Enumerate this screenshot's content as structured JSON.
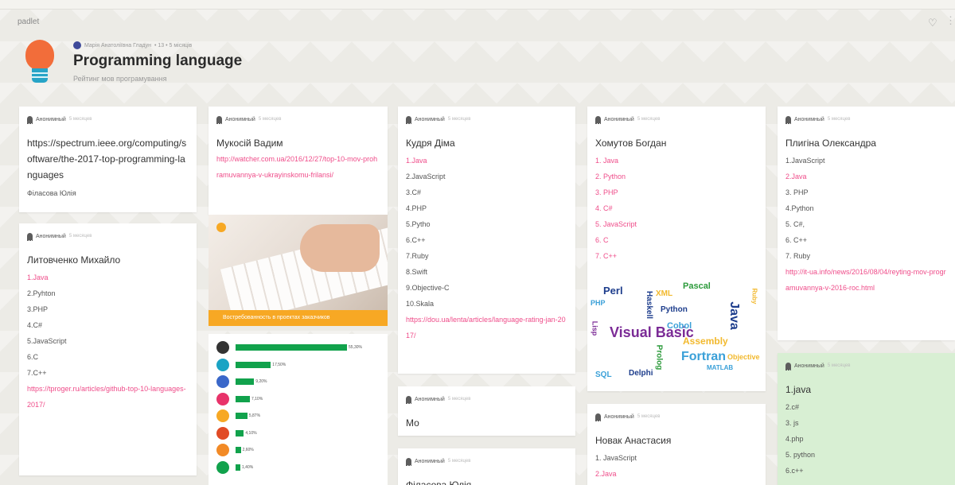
{
  "app": {
    "brand": "padlet",
    "heart_icon": "heart-icon"
  },
  "header": {
    "author": "Марія Анатоліївна Гладун",
    "meta": "• 13 • 5 місяців",
    "title": "Programming language",
    "subtitle": "Рейтинг мов програмування"
  },
  "posts": {
    "c1": {
      "author": "Анонимный",
      "time": "5 месяцев",
      "title": "https://spectrum.ieee.org/computing/software/the-2017-top-programming-languages",
      "body": "Філасова Юлія"
    },
    "c2": {
      "author": "Анонимный",
      "time": "5 месяцев",
      "title": "Литовченко Михайло",
      "items": [
        "1.Java",
        "2.Pyhton",
        "3.PHP",
        "4.C#",
        "5.JavaScript",
        "6.C",
        "7.C++"
      ],
      "link": "https://tproger.ru/articles/github-top-10-languages-2017/"
    },
    "c3": {
      "author": "Анонимный",
      "time": "5 месяцев",
      "title": "Мукосій Вадим",
      "link": "http://watcher.com.ua/2016/12/27/top-10-mov-prohramuvannya-v-ukrayinskomu-frilansi/",
      "image_banner": "Востребованность в проектах заказчиков",
      "bars": [
        {
          "value": 55.3,
          "label": "55,30%",
          "color": "#333333"
        },
        {
          "value": 17.5,
          "label": "17,50%",
          "color": "#1aa3c4"
        },
        {
          "value": 9.2,
          "label": "9,20%",
          "color": "#3a67c9"
        },
        {
          "value": 7.1,
          "label": "7,10%",
          "color": "#e8336a"
        },
        {
          "value": 5.87,
          "label": "5,87%",
          "color": "#f7a824"
        },
        {
          "value": 4.1,
          "label": "4,10%",
          "color": "#e14b25"
        },
        {
          "value": 2.6,
          "label": "2,60%",
          "color": "#f28a26"
        },
        {
          "value": 1.4,
          "label": "1,40%",
          "color": "#11a24c"
        }
      ]
    },
    "c4": {
      "author": "Анонимный",
      "time": "5 месяцев",
      "title": "Кудря Діма",
      "items": [
        "1.Java",
        "2.JavaScript",
        "3.C#",
        "4.PHP",
        "5.Pytho",
        "6.C++",
        "7.Ruby",
        "8.Swift",
        "9.Objective-C",
        "10.Skala"
      ],
      "link": "https://dou.ua/lenta/articles/language-rating-jan-2017/"
    },
    "c5": {
      "author": "Анонимный",
      "time": "5 месяцев",
      "title": "Мо"
    },
    "c6": {
      "author": "Анонимный",
      "time": "5 месяцев",
      "title": "Філасова Юлія"
    },
    "c7": {
      "author": "Анонимный",
      "time": "5 месяцев",
      "title": "Хомутов Богдан",
      "items": [
        "1. Java",
        "2. Python",
        "3. PHP",
        "4. C#",
        "5. JavaScript",
        "6. C",
        "7. C++"
      ],
      "cloud_words": [
        "Perl",
        "PHP",
        "XML",
        "Pascal",
        "Python",
        "Visual Basic",
        "Cobol",
        "Assembly",
        "Java",
        "Fortran",
        "Ruby",
        "Prolog",
        "Haskell",
        "Lisp",
        "MATLAB",
        "Objective",
        "Delphi",
        "SQL"
      ]
    },
    "c8": {
      "author": "Анонимный",
      "time": "5 месяцев",
      "title": "Новак Анастасия",
      "items": [
        "1. JavaScript",
        "2.Java"
      ]
    },
    "c9": {
      "author": "Анонимный",
      "time": "5 месяцев",
      "title": "Плигіна Олександра",
      "items": [
        "1.JavaScript",
        "2.Java",
        "3. PHP",
        "4.Python",
        "5. C#,",
        "6. C++",
        "7. Ruby"
      ],
      "link": "http://it-ua.info/news/2016/08/04/reyting-mov-programuvannya-v-2016-roc.html"
    },
    "c10": {
      "author": "Анонимный",
      "time": "5 месяцев",
      "title": "1.java",
      "items": [
        "2.c#",
        "3. js",
        "4.php",
        "5. python",
        "6.c++"
      ]
    }
  }
}
